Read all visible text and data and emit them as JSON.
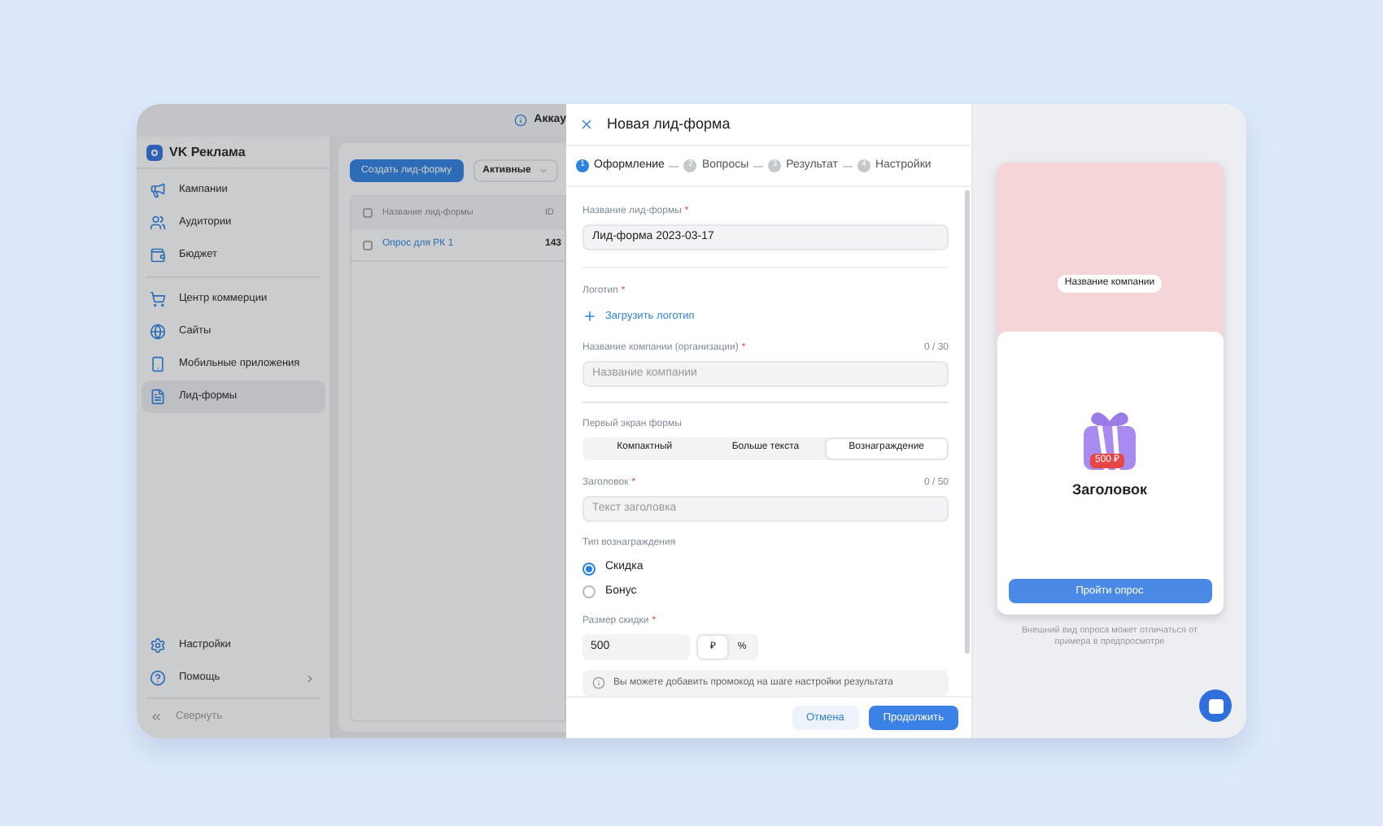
{
  "app": {
    "header_text": "Аккау",
    "logo": "VK Реклама",
    "sidebar": {
      "items": [
        {
          "label": "Кампании",
          "selected": false
        },
        {
          "label": "Аудитории",
          "selected": false
        },
        {
          "label": "Бюджет",
          "selected": false
        },
        {
          "label": "Центр коммерции",
          "selected": false
        },
        {
          "label": "Сайты",
          "selected": false
        },
        {
          "label": "Мобильные приложения",
          "selected": false
        },
        {
          "label": "Лид-формы",
          "selected": true
        }
      ],
      "bottom_items": [
        {
          "label": "Настройки",
          "has_submenu": false
        },
        {
          "label": "Помощь",
          "has_submenu": true
        }
      ],
      "collapse": "Свернуть"
    },
    "toolbar": {
      "create_button": "Создать лид-форму",
      "filter": "Активные"
    },
    "table": {
      "all_checked": false,
      "columns": [
        "Название лид-формы",
        "ID"
      ],
      "rows": [
        {
          "name": "Опрос для РК 1",
          "id": "143",
          "checked": false
        }
      ]
    }
  },
  "modal": {
    "title": "Новая лид-форма",
    "steps": [
      {
        "number": "1",
        "label": "Оформление",
        "selected": true
      },
      {
        "number": "2",
        "label": "Вопросы",
        "selected": false
      },
      {
        "number": "3",
        "label": "Результат",
        "selected": false
      },
      {
        "number": "4",
        "label": "Настройки",
        "selected": false
      }
    ],
    "form_name": {
      "label": "Название лид-формы",
      "required_mark": "*",
      "value": "Лид-форма 2023-03-17"
    },
    "logo": {
      "label": "Логотип",
      "required_mark": "*",
      "upload": "Загрузить логотип"
    },
    "company": {
      "label": "Название компании (организации)",
      "required_mark": "*",
      "counter": "0 / 30",
      "placeholder": "Название компании"
    },
    "first_screen": {
      "label": "Первый экран формы",
      "options": [
        {
          "label": "Компактный",
          "selected": false
        },
        {
          "label": "Больше текста",
          "selected": false
        },
        {
          "label": "Вознаграждение",
          "selected": true
        }
      ]
    },
    "heading": {
      "label": "Заголовок",
      "required_mark": "*",
      "counter": "0 / 50",
      "placeholder": "Текст заголовка"
    },
    "reward_type": {
      "label": "Тип вознаграждения",
      "options": [
        {
          "label": "Скидка",
          "selected": true
        },
        {
          "label": "Бонус",
          "selected": false
        }
      ]
    },
    "discount": {
      "label": "Размер скидки",
      "required_mark": "*",
      "value": "500",
      "units": [
        {
          "label": "₽",
          "selected": true
        },
        {
          "label": "%",
          "selected": false
        }
      ]
    },
    "info": "Вы можете добавить промокод на шаге настройки результата",
    "buttons": {
      "cancel": "Отмена",
      "continue": "Продолжить"
    }
  },
  "preview": {
    "company_badge": "Название компании",
    "price_badge": "500 ₽",
    "heading": "Заголовок",
    "button": "Пройти опрос",
    "note": "Внешний вид опроса может отличаться от примера в предпросмотре"
  }
}
